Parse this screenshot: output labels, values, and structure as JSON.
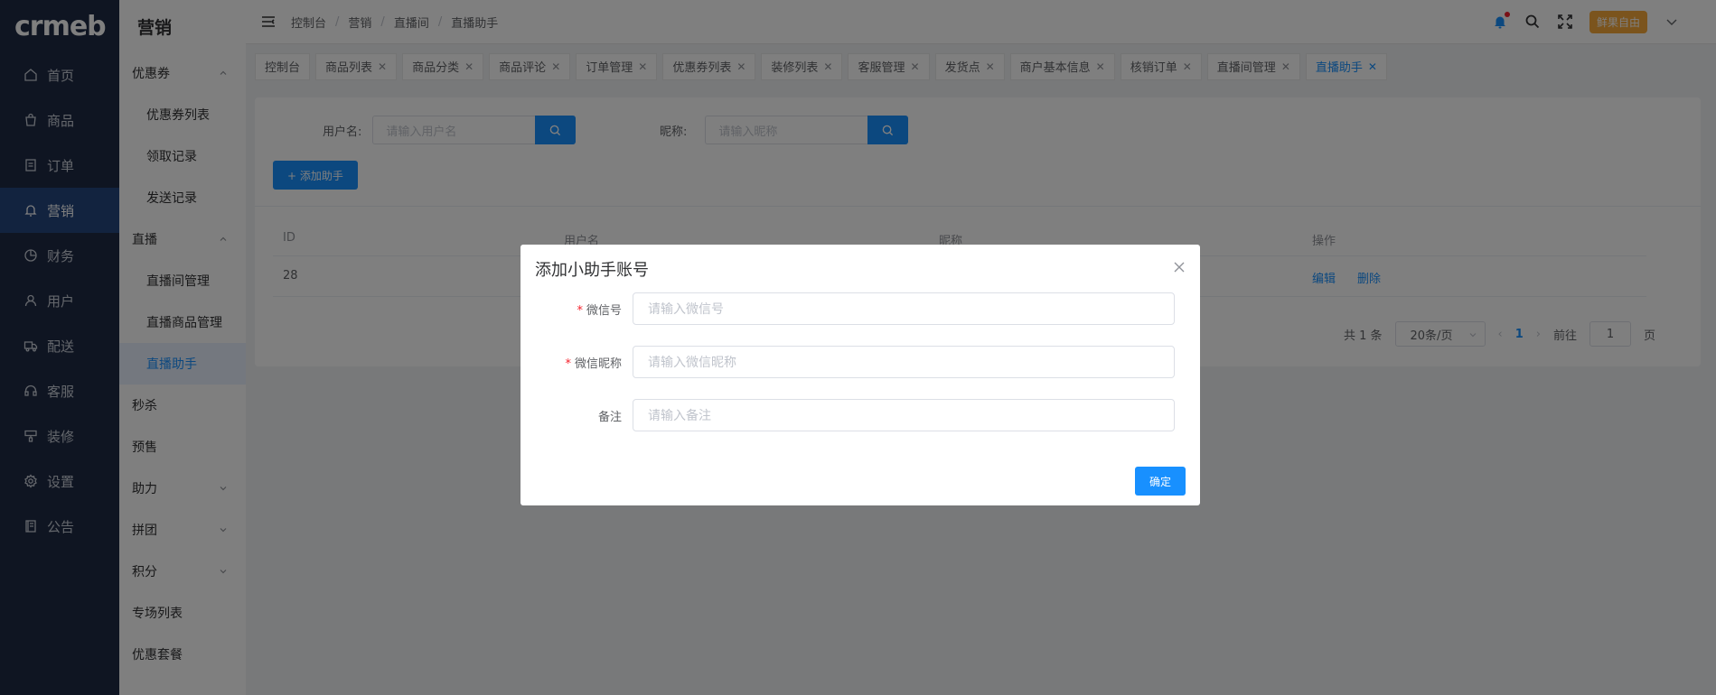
{
  "logo": "crmeb",
  "nav1": [
    {
      "label": "首页",
      "icon": "home-icon"
    },
    {
      "label": "商品",
      "icon": "bag-icon"
    },
    {
      "label": "订单",
      "icon": "document-icon"
    },
    {
      "label": "营销",
      "icon": "bell-icon",
      "active": true
    },
    {
      "label": "财务",
      "icon": "pie-chart-icon"
    },
    {
      "label": "用户",
      "icon": "user-icon"
    },
    {
      "label": "配送",
      "icon": "truck-icon"
    },
    {
      "label": "客服",
      "icon": "headset-icon"
    },
    {
      "label": "装修",
      "icon": "paint-icon"
    },
    {
      "label": "设置",
      "icon": "gear-icon"
    },
    {
      "label": "公告",
      "icon": "notice-icon"
    }
  ],
  "nav2": {
    "title": "营销",
    "coupon_group": "优惠券",
    "coupon_items": [
      "优惠券列表",
      "领取记录",
      "发送记录"
    ],
    "live_group": "直播",
    "live_items": [
      "直播间管理",
      "直播商品管理",
      "直播助手"
    ],
    "seckill": "秒杀",
    "presale": "预售",
    "assist": "助力",
    "group_buy": "拼团",
    "points": "积分",
    "topic_list": "专场列表",
    "combo": "优惠套餐"
  },
  "breadcrumb": [
    "控制台",
    "营销",
    "直播间",
    "直播助手"
  ],
  "header": {
    "user": "鲜果自由"
  },
  "tags": [
    {
      "label": "控制台",
      "closable": false
    },
    {
      "label": "商品列表",
      "closable": true
    },
    {
      "label": "商品分类",
      "closable": true
    },
    {
      "label": "商品评论",
      "closable": true
    },
    {
      "label": "订单管理",
      "closable": true
    },
    {
      "label": "优惠券列表",
      "closable": true
    },
    {
      "label": "装修列表",
      "closable": true
    },
    {
      "label": "客服管理",
      "closable": true
    },
    {
      "label": "发货点",
      "closable": true
    },
    {
      "label": "商户基本信息",
      "closable": true
    },
    {
      "label": "核销订单",
      "closable": true
    },
    {
      "label": "直播间管理",
      "closable": true
    },
    {
      "label": "直播助手",
      "closable": true,
      "active": true
    }
  ],
  "search": {
    "username_label": "用户名:",
    "username_placeholder": "请输入用户名",
    "nickname_label": "昵称:",
    "nickname_placeholder": "请输入昵称"
  },
  "add_button": "+ 添加助手",
  "table": {
    "headers": [
      "ID",
      "用户名",
      "昵称",
      "操作"
    ],
    "row": {
      "id": "28",
      "edit": "编辑",
      "delete": "删除"
    }
  },
  "pagination": {
    "total": "共 1 条",
    "page_size": "20条/页",
    "current": "1",
    "goto_label": "前往",
    "goto_value": "1",
    "page_suffix": "页"
  },
  "dialog": {
    "title": "添加小助手账号",
    "wechat_label": "微信号",
    "wechat_placeholder": "请输入微信号",
    "nickname_label": "微信昵称",
    "nickname_placeholder": "请输入微信昵称",
    "remark_label": "备注",
    "remark_placeholder": "请输入备注",
    "confirm": "确定"
  }
}
